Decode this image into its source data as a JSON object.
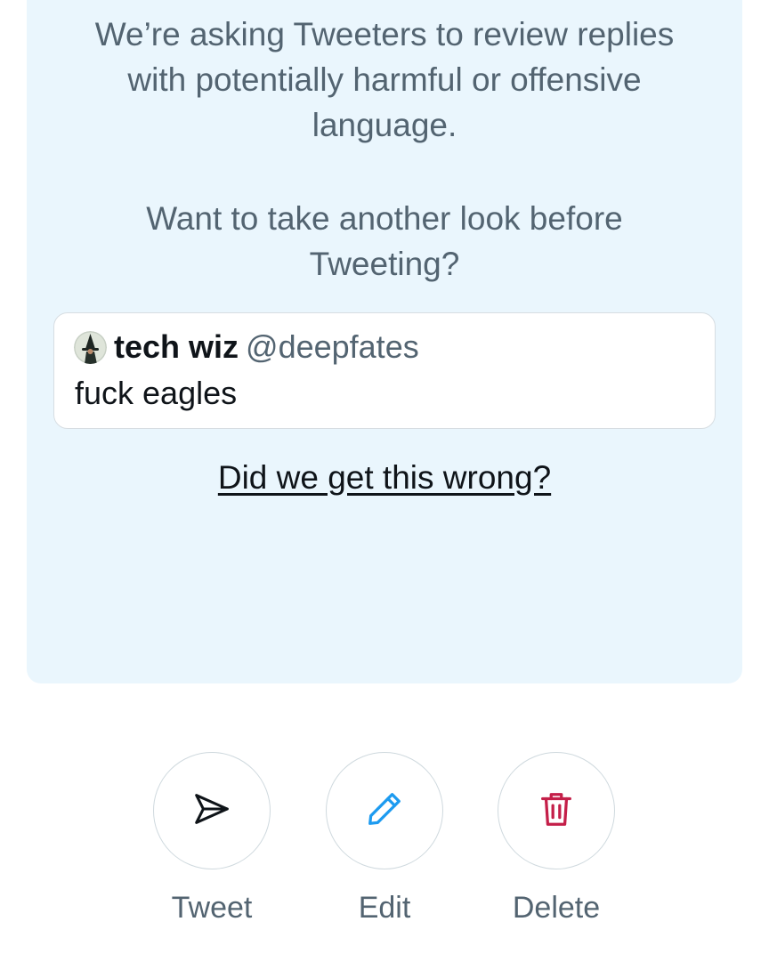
{
  "prompt": {
    "line1": "We’re asking Tweeters to review replies",
    "line2": "with potentially harmful or offensive",
    "line3": "language.",
    "question_line1": "Want to take another look before",
    "question_line2": "Tweeting?"
  },
  "tweet": {
    "author_name": "tech wiz",
    "author_handle": "@deepfates",
    "text": "fuck eagles",
    "avatar_icon": "avatar-wizard"
  },
  "feedback_link": "Did we get this wrong?",
  "actions": [
    {
      "label": "Tweet",
      "icon": "send-icon",
      "color": "#0f1419"
    },
    {
      "label": "Edit",
      "icon": "pencil-icon",
      "color": "#1d9bf0"
    },
    {
      "label": "Delete",
      "icon": "trash-icon",
      "color": "#c41f49"
    }
  ],
  "colors": {
    "panel_bg": "#eaf6fd",
    "secondary_text": "#536471",
    "primary_text": "#0f1419"
  }
}
